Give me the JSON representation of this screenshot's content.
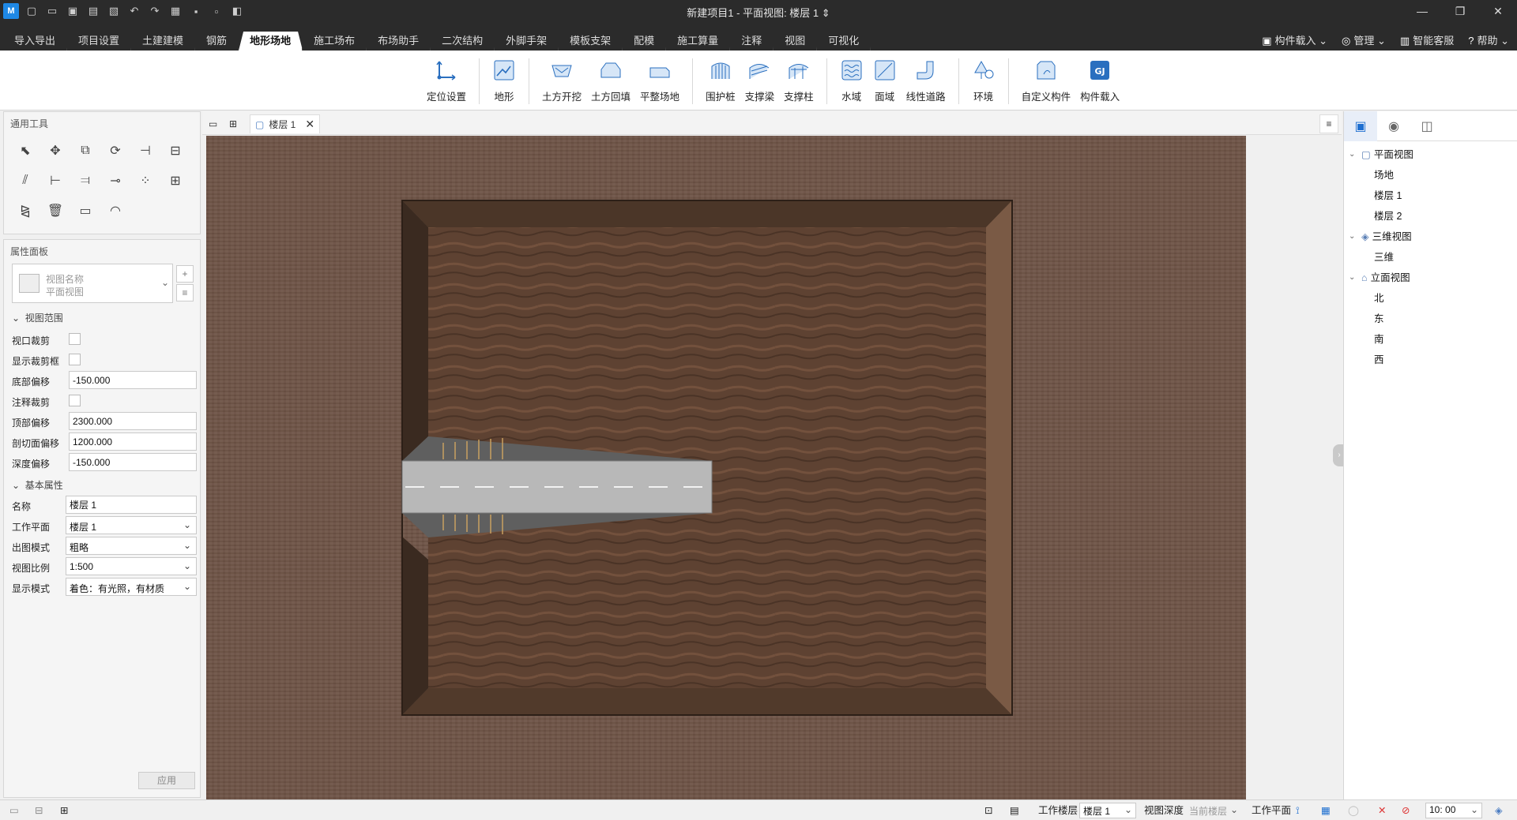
{
  "window": {
    "title": "新建项目1 - 平面视图: 楼层 1",
    "logo": "M",
    "controls": [
      "—",
      "❐",
      "✕"
    ]
  },
  "quick_access": [
    "new-icon",
    "open-icon",
    "save-icon",
    "save-as-icon",
    "export-icon",
    "undo-icon",
    "redo-icon",
    "tool1-icon",
    "tool2-icon",
    "tool3-icon",
    "tool4-icon"
  ],
  "menu_tabs": [
    "导入导出",
    "项目设置",
    "土建建模",
    "钢筋",
    "地形场地",
    "施工场布",
    "布场助手",
    "二次结构",
    "外脚手架",
    "模板支架",
    "配模",
    "施工算量",
    "注释",
    "视图",
    "可视化"
  ],
  "active_tab": "地形场地",
  "top_right": {
    "import": "构件载入",
    "manage": "管理",
    "service": "智能客服",
    "help": "帮助"
  },
  "ribbon": {
    "groups": [
      [
        {
          "label": "定位设置",
          "icon": "locate-icon"
        }
      ],
      [
        {
          "label": "地形",
          "icon": "terrain-icon"
        }
      ],
      [
        {
          "label": "土方开挖",
          "icon": "excavation-icon"
        },
        {
          "label": "土方回填",
          "icon": "backfill-icon"
        },
        {
          "label": "平整场地",
          "icon": "level-site-icon"
        }
      ],
      [
        {
          "label": "围护桩",
          "icon": "retaining-pile-icon"
        },
        {
          "label": "支撑梁",
          "icon": "support-beam-icon"
        },
        {
          "label": "支撑柱",
          "icon": "support-column-icon"
        }
      ],
      [
        {
          "label": "水域",
          "icon": "water-icon"
        },
        {
          "label": "面域",
          "icon": "region-icon"
        },
        {
          "label": "线性道路",
          "icon": "road-icon"
        }
      ],
      [
        {
          "label": "环境",
          "icon": "environment-icon"
        }
      ],
      [
        {
          "label": "自定义构件",
          "icon": "custom-component-icon"
        },
        {
          "label": "构件载入",
          "icon": "component-load-icon"
        }
      ]
    ]
  },
  "tools_panel": {
    "title": "通用工具"
  },
  "properties": {
    "title": "属性面板",
    "view_name_label": "视图名称",
    "view_name_value": "平面视图",
    "section_view_range": "视图范围",
    "viewport_clip": "视口裁剪",
    "show_clip_box": "显示裁剪框",
    "bottom_offset_label": "底部偏移",
    "bottom_offset": "-150.000",
    "annotation_clip": "注释裁剪",
    "top_offset_label": "顶部偏移",
    "top_offset": "2300.000",
    "cut_offset_label": "剖切面偏移",
    "cut_offset": "1200.000",
    "depth_offset_label": "深度偏移",
    "depth_offset": "-150.000",
    "section_basic": "基本属性",
    "name_label": "名称",
    "name_value": "楼层 1",
    "work_plane_label": "工作平面",
    "work_plane_value": "楼层 1",
    "output_mode_label": "出图模式",
    "output_mode_value": "粗略",
    "scale_label": "视图比例",
    "scale_value": "1:500",
    "display_mode_label": "显示模式",
    "display_mode_value": "着色：有光照，有材质",
    "apply": "应用"
  },
  "doc_tabs": {
    "active": "楼层 1",
    "close": "✕",
    "menu": "≡"
  },
  "view_tree": {
    "plan": "平面视图",
    "plan_items": [
      "场地",
      "楼层 1",
      "楼层 2"
    ],
    "three_d": "三维视图",
    "three_d_items": [
      "三维"
    ],
    "elevation": "立面视图",
    "elevation_items": [
      "北",
      "东",
      "南",
      "西"
    ]
  },
  "status": {
    "work_floor_label": "工作楼层",
    "work_floor_value": "楼层 1",
    "view_depth_label": "视图深度",
    "view_depth_value": "当前楼层",
    "work_plane_label": "工作平面",
    "time": "10: 00"
  },
  "colors": {
    "accent": "#1e88e5",
    "dark_bar": "#2b2b2b",
    "soil": "#6e5446"
  }
}
